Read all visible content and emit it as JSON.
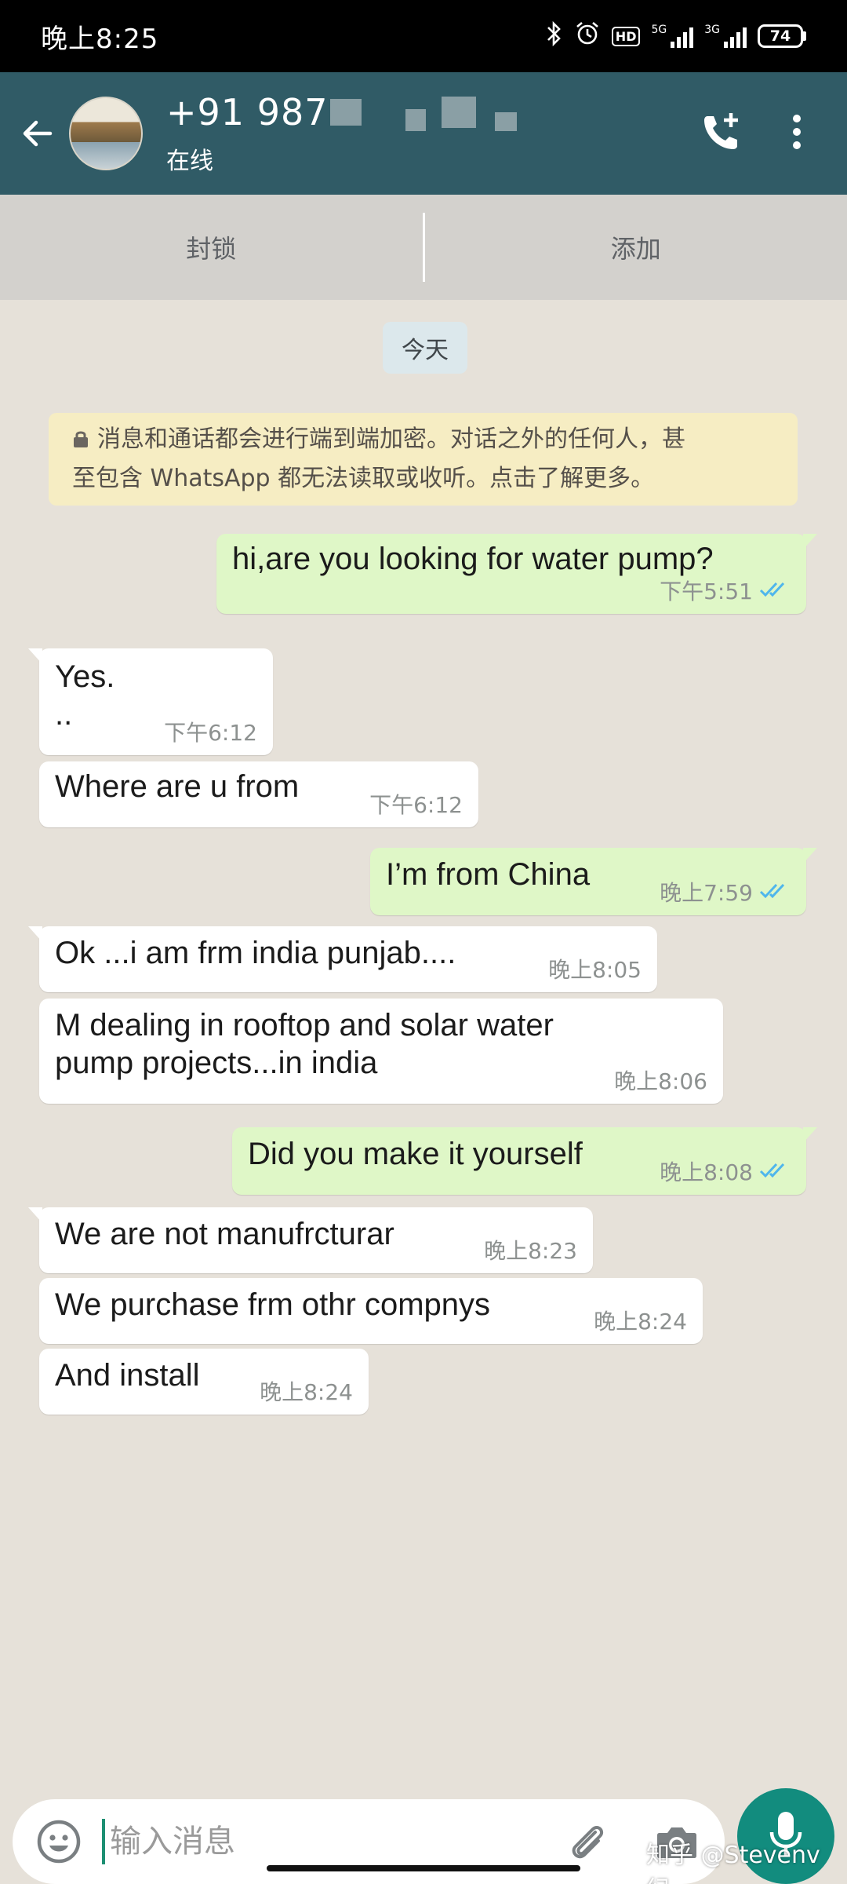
{
  "status_bar": {
    "time": "晚上8:25",
    "hd_label": "HD",
    "net1": "5G",
    "net2": "3G",
    "battery": "74"
  },
  "header": {
    "contact_name_visible": "+91 987",
    "contact_status": "在线"
  },
  "action_bar": {
    "block_label": "封锁",
    "add_label": "添加"
  },
  "chat": {
    "date_chip": "今天",
    "encryption_notice_line1": "消息和通话都会进行端到端加密。对话之外的任何人，甚",
    "encryption_notice_line2": "至包含 WhatsApp 都无法读取或收听。点击了解更多。",
    "messages": [
      {
        "direction": "out",
        "text": "hi,are you looking for water pump?",
        "time": "下午5:51",
        "read": true
      },
      {
        "direction": "in",
        "text": "Yes.",
        "text2": "..",
        "time": "下午6:12"
      },
      {
        "direction": "in",
        "text": "Where are u from",
        "time": "下午6:12"
      },
      {
        "direction": "out",
        "text": "I’m from China",
        "time": "晚上7:59",
        "read": true
      },
      {
        "direction": "in",
        "text": "Ok ...i am frm india punjab....",
        "time": "晚上8:05"
      },
      {
        "direction": "in",
        "text": "M dealing in rooftop and solar water",
        "text2": "pump projects...in india",
        "time": "晚上8:06"
      },
      {
        "direction": "out",
        "text": "Did you make it yourself",
        "time": "晚上8:08",
        "read": true
      },
      {
        "direction": "in",
        "text": "We are not manufrcturar",
        "time": "晚上8:23"
      },
      {
        "direction": "in",
        "text": "We purchase frm othr compnys",
        "time": "晚上8:24"
      },
      {
        "direction": "in",
        "text": "And install",
        "time": "晚上8:24"
      }
    ]
  },
  "composer": {
    "placeholder": "输入消息"
  },
  "watermark": "知乎 @Stevenv 纪",
  "colors": {
    "header": "#305b66",
    "outgoing_bubble": "#dff7c7",
    "incoming_bubble": "#ffffff",
    "mic_button": "#128c7e",
    "read_ticks": "#4fb6ec"
  }
}
